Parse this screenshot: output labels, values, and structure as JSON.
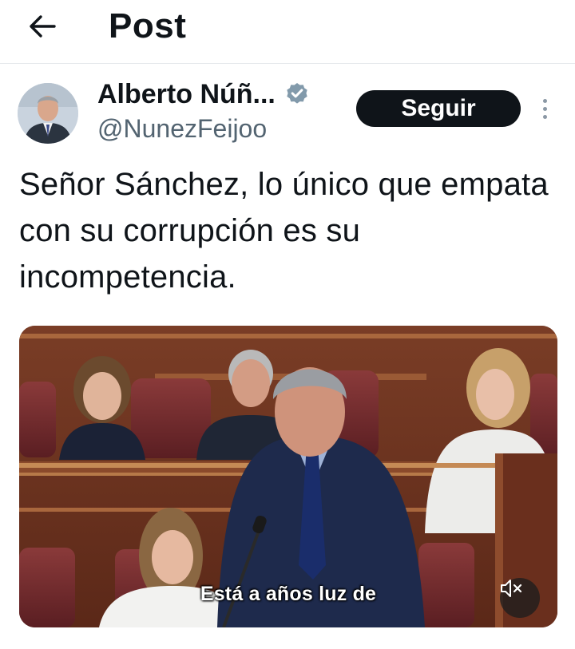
{
  "header": {
    "title": "Post",
    "back_icon": "arrow-left-icon"
  },
  "author": {
    "name": "Alberto Núñ...",
    "handle": "@NunezFeijoo",
    "verified": true,
    "verified_color": "#829aab",
    "follow_label": "Seguir"
  },
  "tweet": {
    "text": "Señor Sánchez, lo único que empata con su corrupción es su incompetencia."
  },
  "media": {
    "caption": "Está a años luz de",
    "mute_icon": "speaker-muted-icon"
  },
  "colors": {
    "text": "#0f1419",
    "secondary": "#536471",
    "follow_bg": "#0f1419",
    "divider": "#e6e9ec"
  }
}
